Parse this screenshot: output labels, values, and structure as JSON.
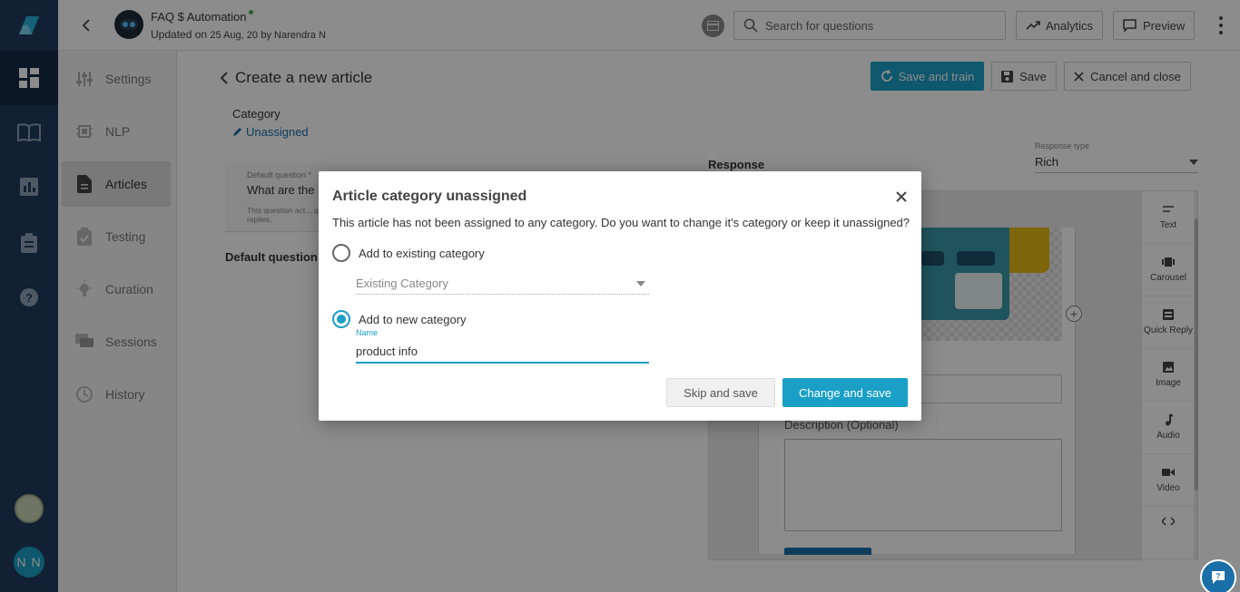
{
  "header": {
    "bot_name": "FAQ $ Automation",
    "updated_prefix": "Updated on",
    "updated_date": "25 Aug, 20",
    "updated_by": "by Narendra N",
    "search_placeholder": "Search for questions",
    "analytics_label": "Analytics",
    "preview_label": "Preview"
  },
  "user": {
    "initials": "N N"
  },
  "subnav": {
    "items": [
      {
        "label": "Settings",
        "icon": "sliders-icon"
      },
      {
        "label": "NLP",
        "icon": "chip-icon"
      },
      {
        "label": "Articles",
        "icon": "document-icon",
        "active": true
      },
      {
        "label": "Testing",
        "icon": "clipboard-check-icon"
      },
      {
        "label": "Curation",
        "icon": "lightbulb-icon"
      },
      {
        "label": "Sessions",
        "icon": "chat-bubbles-icon"
      },
      {
        "label": "History",
        "icon": "clock-icon"
      }
    ]
  },
  "page": {
    "title": "Create a new article",
    "save_and_train": "Save and train",
    "save": "Save",
    "cancel_and_close": "Cancel and close",
    "category_label": "Category",
    "category_value": "Unassigned",
    "default_question_label": "Default question *",
    "default_question_value": "What are the",
    "default_question_hint": "This question act... quick replies.",
    "default_question_heading": "Default question",
    "response_heading": "Response",
    "response_type_label": "Response type",
    "response_type_value": "Rich",
    "description_label": "Description (Optional)"
  },
  "tools": [
    {
      "label": "Text",
      "icon": "text-icon"
    },
    {
      "label": "Carousel",
      "icon": "carousel-icon"
    },
    {
      "label": "Quick Reply",
      "icon": "quick-reply-icon"
    },
    {
      "label": "Image",
      "icon": "image-icon"
    },
    {
      "label": "Audio",
      "icon": "music-note-icon"
    },
    {
      "label": "Video",
      "icon": "video-icon"
    },
    {
      "label": "",
      "icon": "code-icon"
    }
  ],
  "modal": {
    "title": "Article category unassigned",
    "message": "This article has not been assigned to any category. Do you want to change it's category or keep it unassigned?",
    "option_existing": "Add to existing category",
    "existing_placeholder": "Existing Category",
    "option_new": "Add to new category",
    "selected_option": "new",
    "name_label": "Name",
    "name_value": "product info",
    "skip_label": "Skip and save",
    "change_label": "Change and save"
  },
  "colors": {
    "rail": "#1f3c5e",
    "accent": "#1a9fc6",
    "link": "#1a6fa8"
  }
}
